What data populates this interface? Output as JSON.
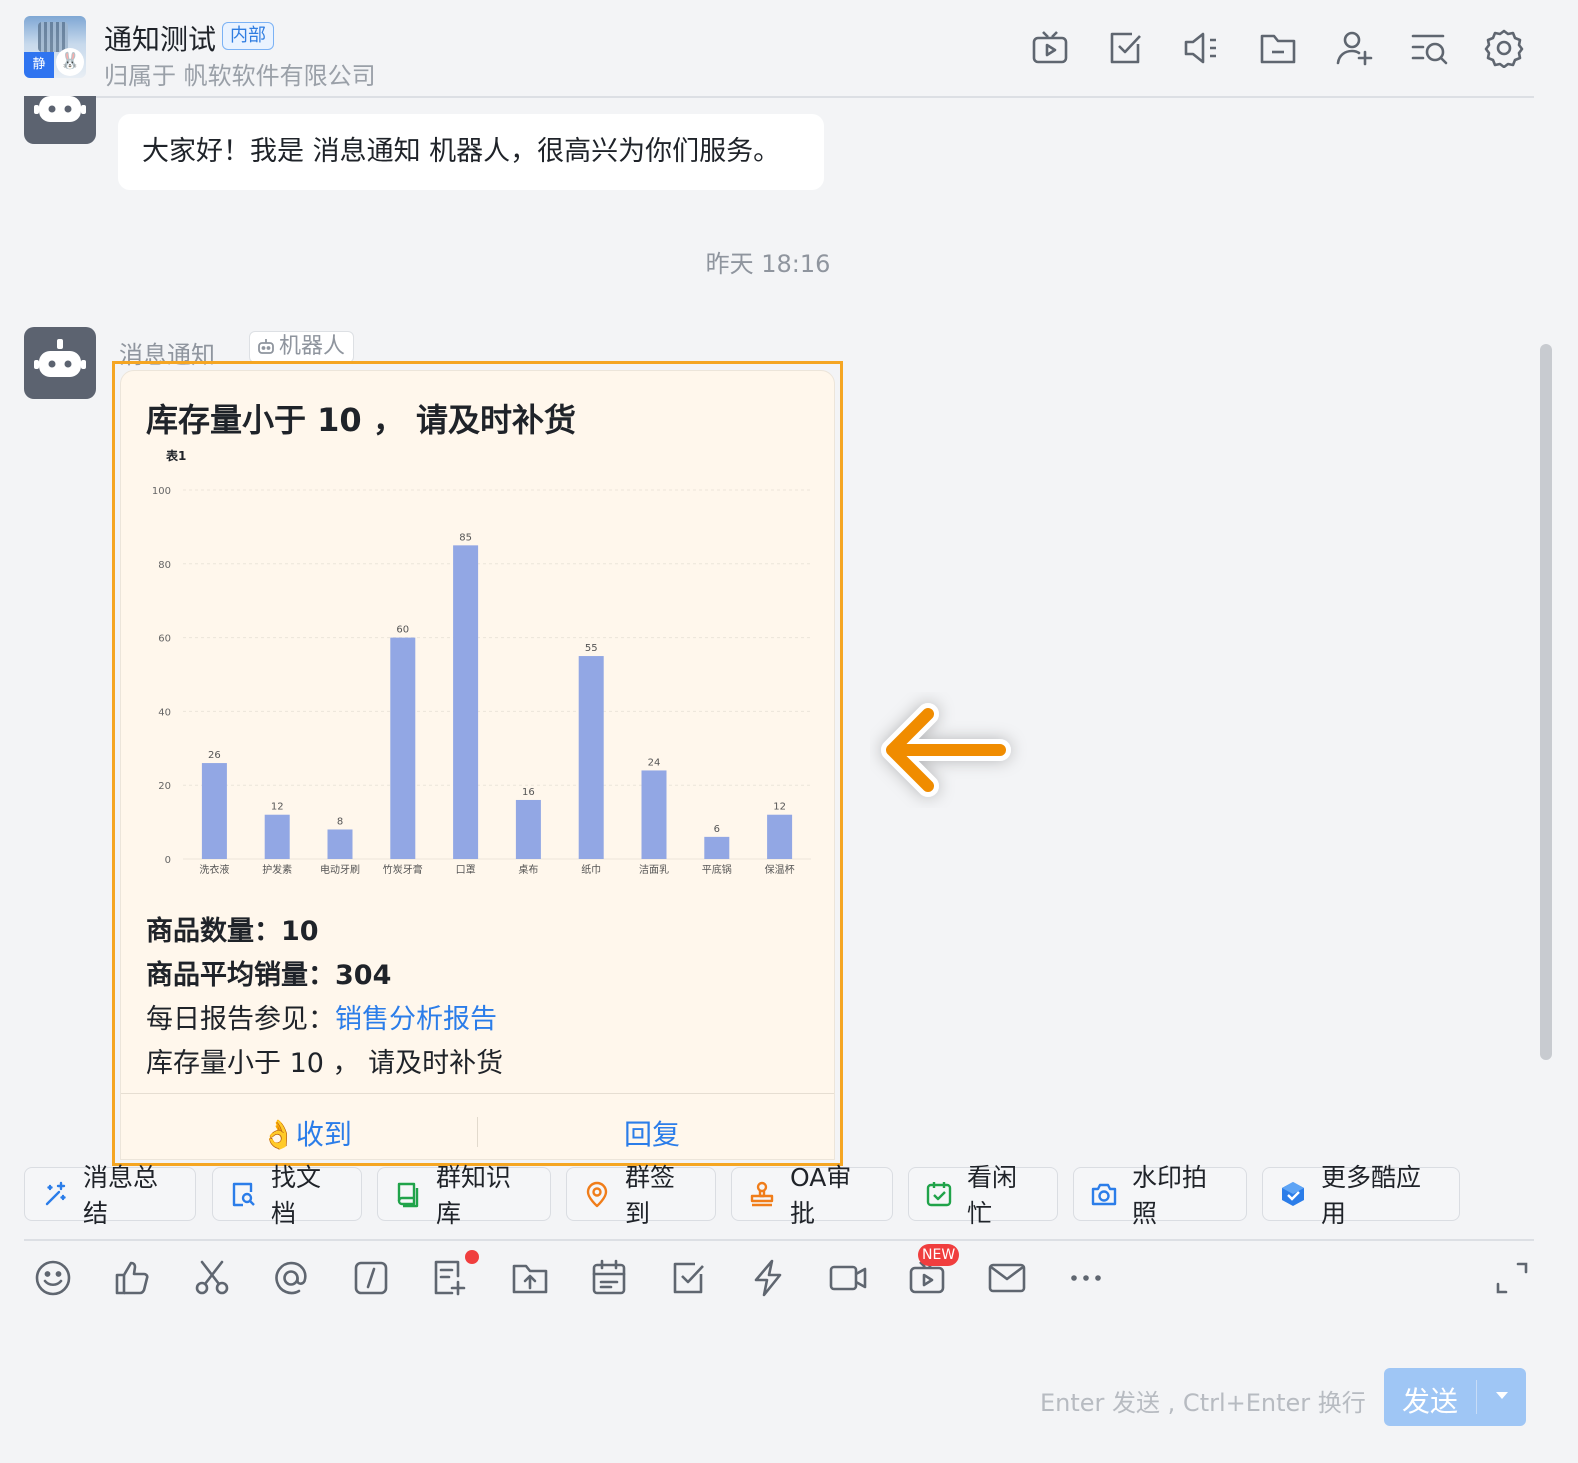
{
  "header": {
    "group_avatar_tag": "静",
    "title": "通知测试",
    "badge": "内部",
    "subtitle": "归属于 帆软软件有限公司",
    "icons": [
      "video-icon",
      "task-icon",
      "announcement-icon",
      "folder-icon",
      "add-member-icon",
      "search-history-icon",
      "settings-icon"
    ]
  },
  "messages": {
    "first": {
      "sender": "消息通知",
      "tag": "机器人",
      "text": "大家好！我是 消息通知 机器人，很高兴为你们服务。"
    },
    "timestamp": "昨天 18:16",
    "second": {
      "sender": "消息通知",
      "tag": "机器人"
    }
  },
  "card": {
    "title": "库存量小于 10 ， 请及时补货",
    "line1_label": "商品数量：",
    "line1_value": "10",
    "line2_label": "商品平均销量：",
    "line2_value": "304",
    "line3_label": "每日报告参见：",
    "line3_link": "销售分析报告",
    "line4": "库存量小于 10 ， 请及时补货",
    "btn_ack_emoji": "👌",
    "btn_ack": "收到",
    "btn_reply": "回复"
  },
  "chart_data": {
    "type": "bar",
    "title": "表1",
    "categories": [
      "洗衣液",
      "护发素",
      "电动牙刷",
      "竹炭牙膏",
      "口罩",
      "桌布",
      "纸巾",
      "洁面乳",
      "平底锅",
      "保温杯"
    ],
    "values": [
      26,
      12,
      8,
      60,
      85,
      16,
      55,
      24,
      6,
      12
    ],
    "yticks": [
      0,
      20,
      40,
      60,
      80,
      100
    ],
    "ylim": [
      0,
      100
    ],
    "bar_color": "#92a7e4",
    "grid": true
  },
  "quick_apps": [
    {
      "label": "消息总结",
      "icon": "ai-sparkle-icon"
    },
    {
      "label": "找文档",
      "icon": "doc-search-icon"
    },
    {
      "label": "群知识库",
      "icon": "knowledge-base-icon"
    },
    {
      "label": "群签到",
      "icon": "location-checkin-icon"
    },
    {
      "label": "OA审批",
      "icon": "approval-stamp-icon"
    },
    {
      "label": "看闲忙",
      "icon": "calendar-check-icon"
    },
    {
      "label": "水印拍照",
      "icon": "camera-icon"
    },
    {
      "label": "更多酷应用",
      "icon": "more-apps-icon"
    }
  ],
  "toolbar": {
    "new_badge": "NEW",
    "icons": [
      "emoji-icon",
      "thumbs-up-icon",
      "scissors-icon",
      "mention-icon",
      "slash-command-icon",
      "new-doc-icon",
      "upload-file-icon",
      "schedule-icon",
      "todo-icon",
      "lightning-icon",
      "video-call-icon",
      "live-icon",
      "mail-icon",
      "more-icon",
      "expand-icon"
    ]
  },
  "composer": {
    "hint": "Enter 发送 , Ctrl+Enter 换行",
    "send_label": "发送"
  },
  "colors": {
    "accent": "#2b7de9",
    "highlight": "#f5a623",
    "arrow": "#f08c00"
  }
}
